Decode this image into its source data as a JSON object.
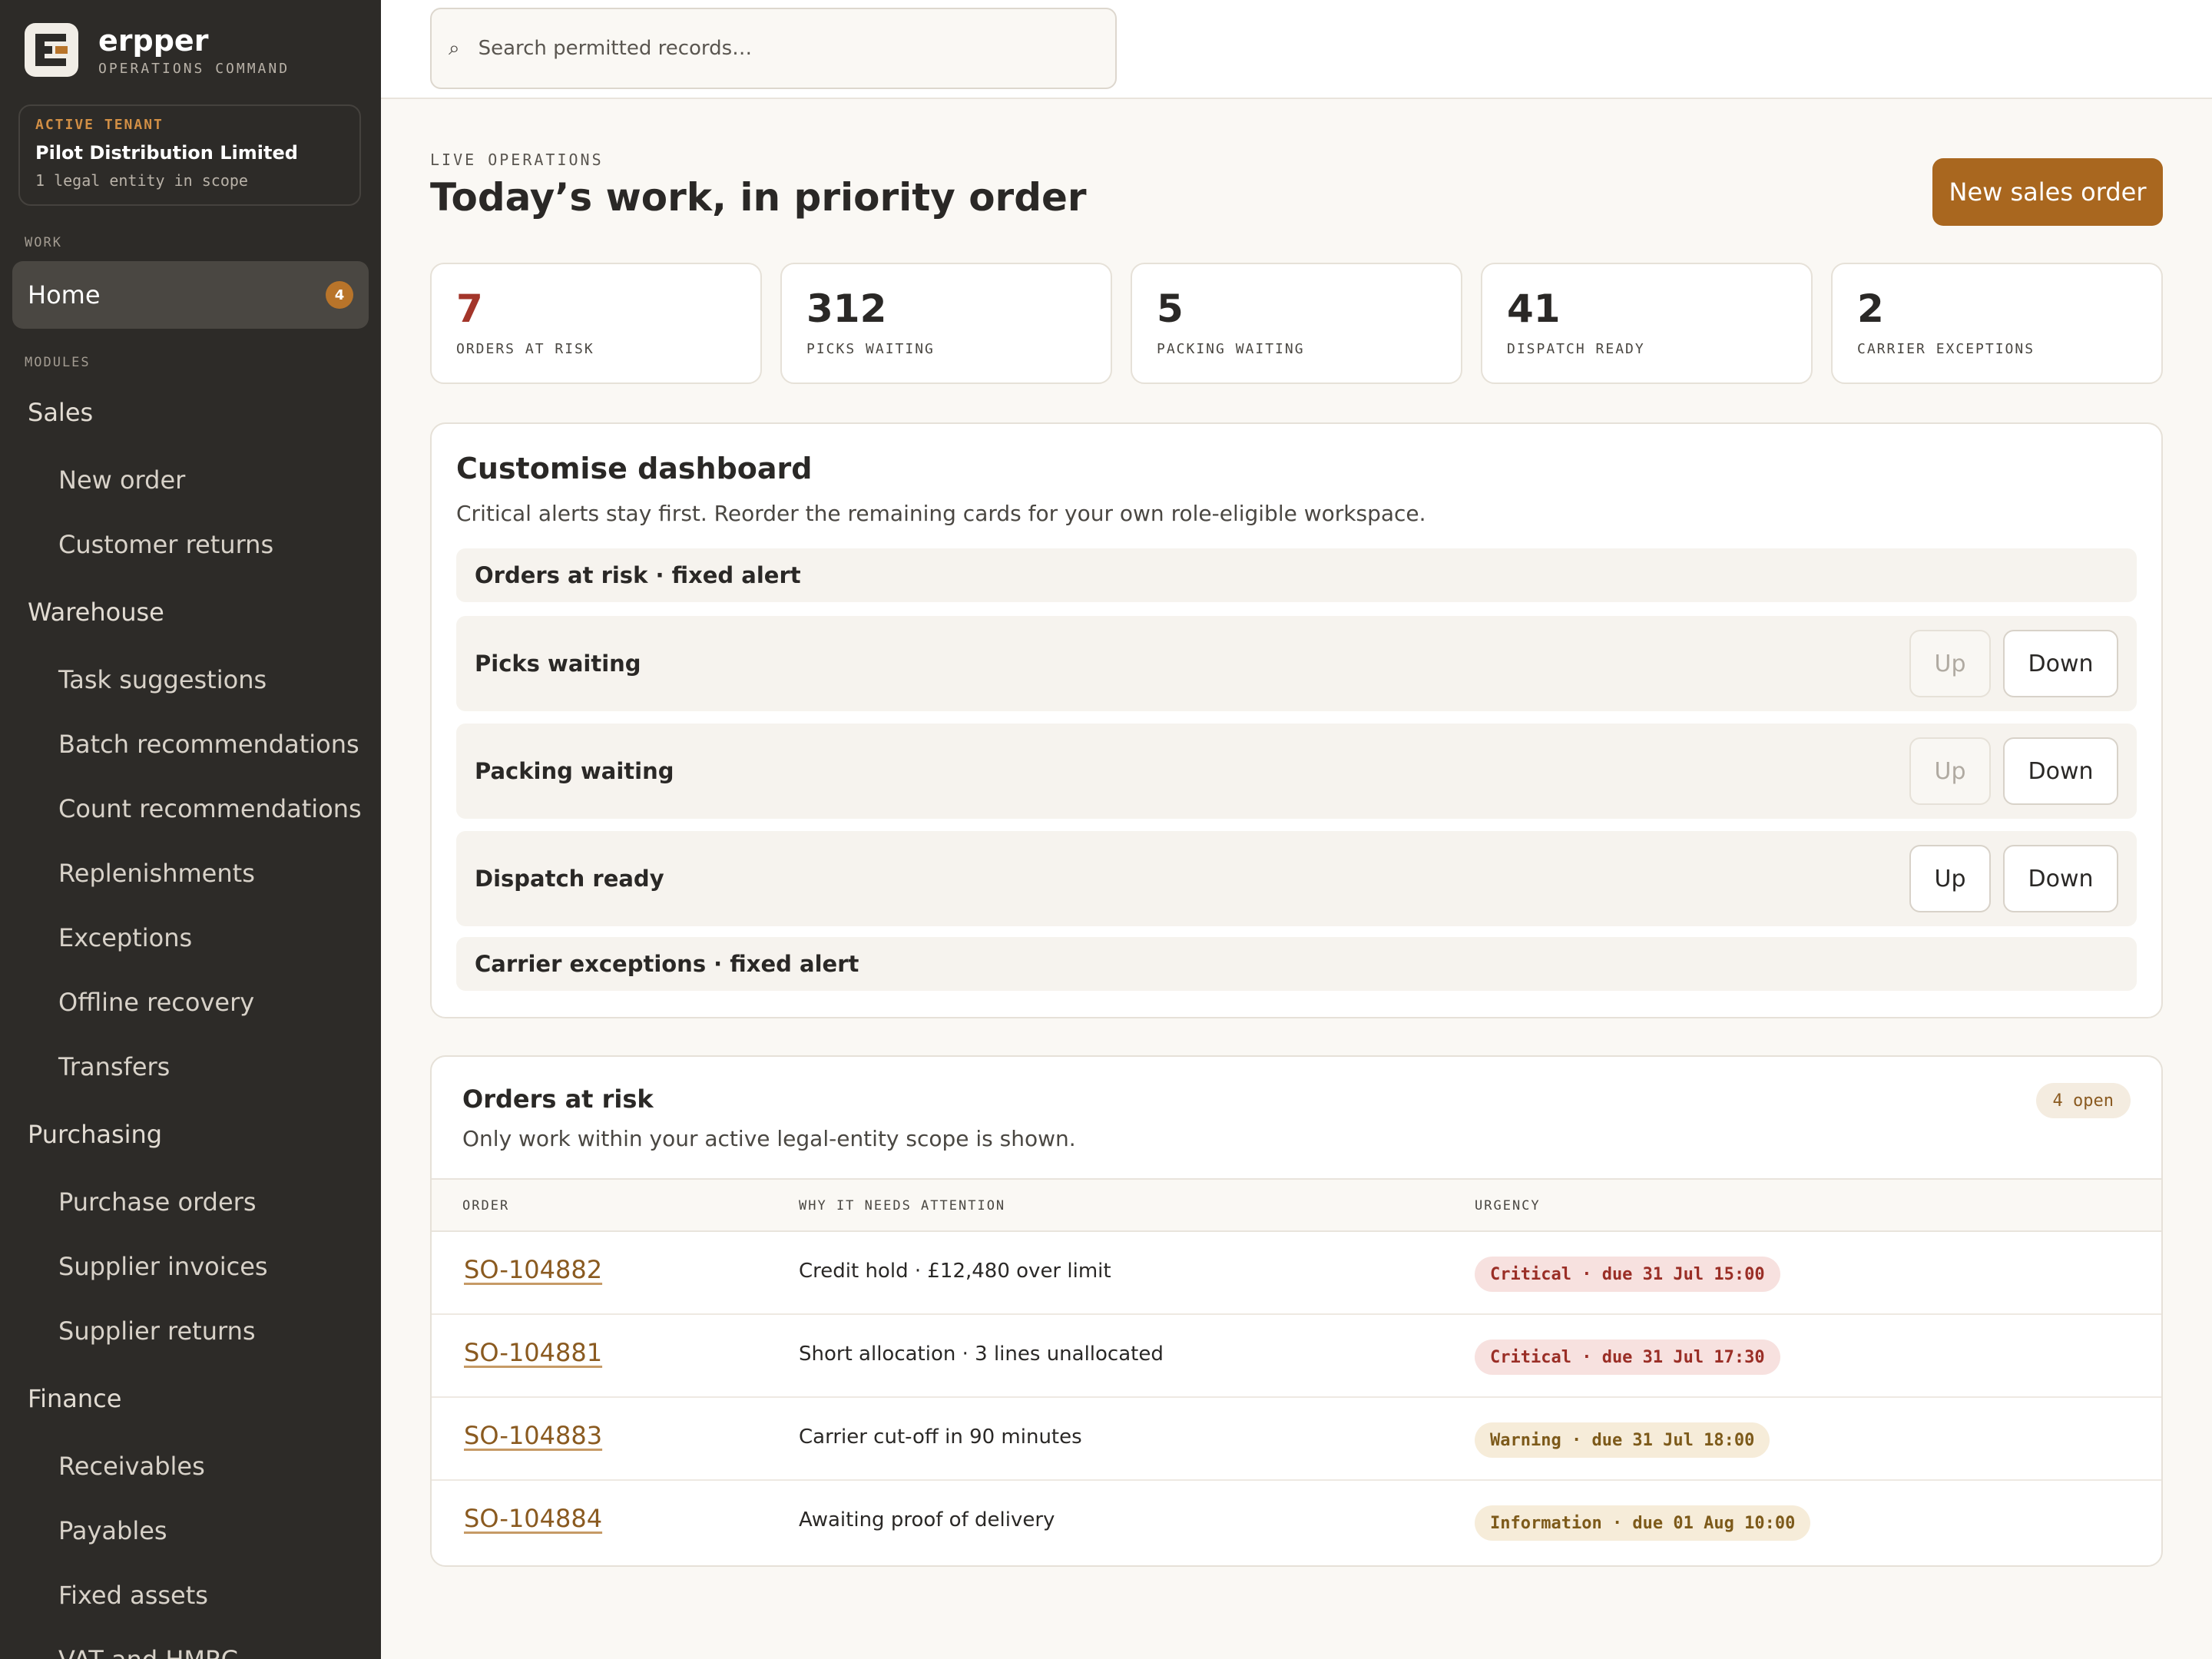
{
  "brand": {
    "name": " erpper",
    "subtitle": "OPERATIONS COMMAND"
  },
  "tenant": {
    "label": "ACTIVE TENANT",
    "name": "Pilot Distribution Limited",
    "scope": "1 legal entity in scope"
  },
  "nav": {
    "work_label": "WORK",
    "home": {
      "label": "Home",
      "badge": "4"
    },
    "modules_label": "MODULES",
    "sales": {
      "label": "Sales",
      "items": [
        "New order",
        "Customer returns"
      ]
    },
    "warehouse": {
      "label": "Warehouse",
      "items": [
        "Task suggestions",
        "Batch recommendations",
        "Count recommendations",
        "Replenishments",
        "Exceptions",
        "Offline recovery",
        "Transfers"
      ]
    },
    "purchasing": {
      "label": "Purchasing",
      "items": [
        "Purchase orders",
        "Supplier invoices",
        "Supplier returns"
      ]
    },
    "finance": {
      "label": "Finance",
      "items": [
        "Receivables",
        "Payables",
        "Fixed assets",
        "VAT and HMRC"
      ]
    }
  },
  "search": {
    "placeholder": "Search permitted records…",
    "value": ""
  },
  "header": {
    "eyebrow": "LIVE OPERATIONS",
    "title": "Today’s work, in priority order",
    "primary_action": "New sales order"
  },
  "stats": [
    {
      "value": "7",
      "label": "ORDERS AT RISK"
    },
    {
      "value": "312",
      "label": "PICKS WAITING"
    },
    {
      "value": "5",
      "label": "PACKING WAITING"
    },
    {
      "value": "41",
      "label": "DISPATCH READY"
    },
    {
      "value": "2",
      "label": "CARRIER EXCEPTIONS"
    }
  ],
  "customise": {
    "title": "Customise dashboard",
    "description": "Critical alerts stay first. Reorder the remaining cards for your own role-eligible workspace.",
    "up_label": "Up",
    "down_label": "Down",
    "rows": [
      {
        "label": "Orders at risk · fixed alert"
      },
      {
        "label": "Picks waiting"
      },
      {
        "label": "Packing waiting"
      },
      {
        "label": "Dispatch ready"
      },
      {
        "label": "Carrier exceptions · fixed alert"
      }
    ]
  },
  "orders": {
    "title": "Orders at risk",
    "description": "Only work within your active legal-entity scope is shown.",
    "count": "4 open",
    "columns": [
      "ORDER",
      "WHY IT NEEDS ATTENTION",
      "URGENCY"
    ],
    "rows": [
      {
        "order": "SO-104882",
        "why": "Credit hold · £12,480 over limit",
        "urgency": "Critical · due 31 Jul 15:00"
      },
      {
        "order": "SO-104881",
        "why": "Short allocation · 3 lines unallocated",
        "urgency": "Critical · due 31 Jul 17:30"
      },
      {
        "order": "SO-104883",
        "why": "Carrier cut-off in 90 minutes",
        "urgency": "Warning · due 31 Jul 18:00"
      },
      {
        "order": "SO-104884",
        "why": "Awaiting proof of delivery",
        "urgency": "Information · due 01 Aug 10:00"
      }
    ]
  },
  "colors": {
    "accent": "#a9671f",
    "sidebar": "#2d2b28",
    "critical": "#9a2e26",
    "warning": "#7d5a1a"
  }
}
